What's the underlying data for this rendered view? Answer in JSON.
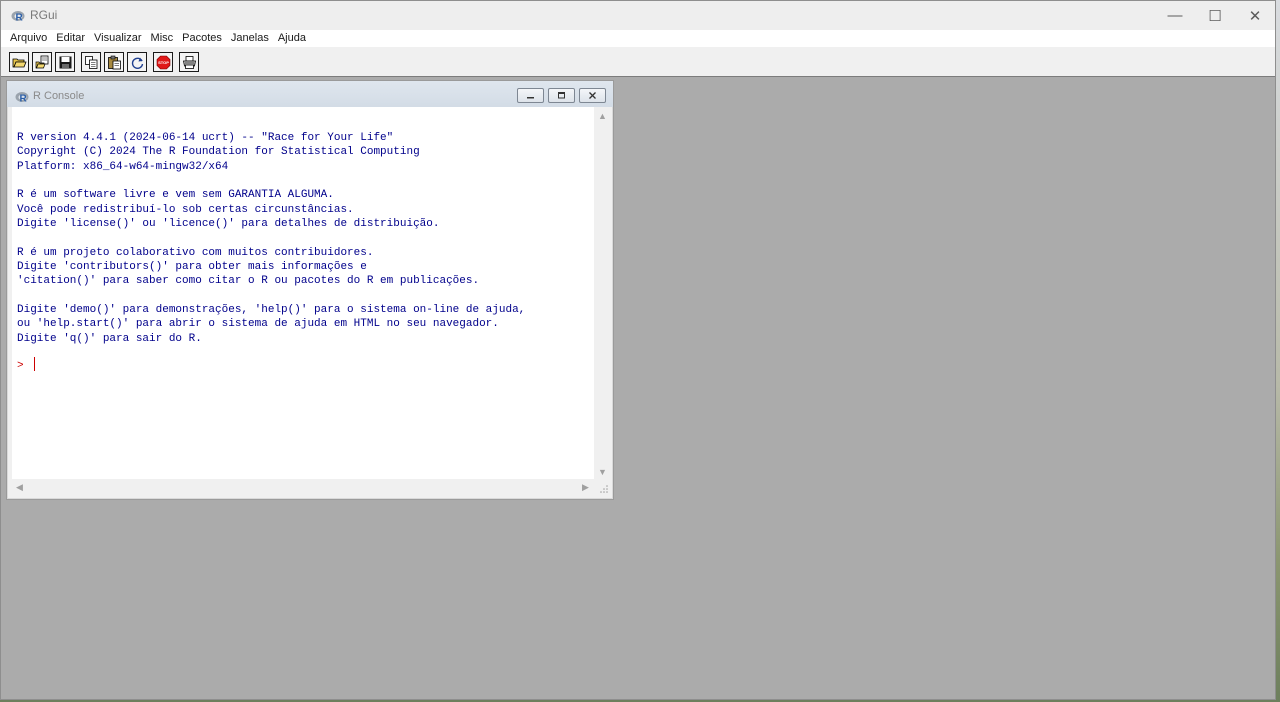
{
  "app": {
    "title": "RGui"
  },
  "window_controls": {
    "minimize": "—",
    "maximize": "☐",
    "close": "✕"
  },
  "menu": [
    {
      "label": "Arquivo"
    },
    {
      "label": "Editar"
    },
    {
      "label": "Visualizar"
    },
    {
      "label": "Misc"
    },
    {
      "label": "Pacotes"
    },
    {
      "label": "Janelas"
    },
    {
      "label": "Ajuda"
    }
  ],
  "toolbar": {
    "buttons": [
      {
        "name": "open-script",
        "icon": "folder-open-icon"
      },
      {
        "name": "load-workspace",
        "icon": "load-workspace-icon"
      },
      {
        "name": "save-workspace",
        "icon": "floppy-disk-icon"
      },
      {
        "name": "copy",
        "icon": "copy-icon"
      },
      {
        "name": "paste",
        "icon": "paste-icon"
      },
      {
        "name": "copy-paste",
        "icon": "refresh-icon"
      },
      {
        "name": "stop",
        "icon": "stop-icon"
      },
      {
        "name": "print",
        "icon": "printer-icon"
      }
    ],
    "stop_label": "STOP"
  },
  "console": {
    "title": "R Console",
    "output": "R version 4.4.1 (2024-06-14 ucrt) -- \"Race for Your Life\"\nCopyright (C) 2024 The R Foundation for Statistical Computing\nPlatform: x86_64-w64-mingw32/x64\n\nR é um software livre e vem sem GARANTIA ALGUMA.\nVocê pode redistribuí-lo sob certas circunstâncias.\nDigite 'license()' ou 'licence()' para detalhes de distribuição.\n\nR é um projeto colaborativo com muitos contribuidores.\nDigite 'contributors()' para obter mais informações e\n'citation()' para saber como citar o R ou pacotes do R em publicações.\n\nDigite 'demo()' para demonstrações, 'help()' para o sistema on-line de ajuda,\nou 'help.start()' para abrir o sistema de ajuda em HTML no seu navegador.\nDigite 'q()' para sair do R.",
    "prompt": ">",
    "output_color": "#00008b",
    "prompt_color": "#cc0000"
  }
}
